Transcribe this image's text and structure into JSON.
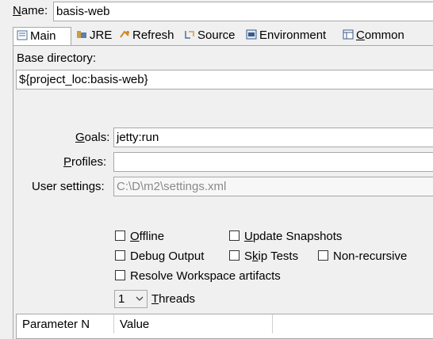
{
  "name": {
    "label_prefix": "N",
    "label_rest": "ame:",
    "value": "basis-web"
  },
  "tabs": [
    {
      "label": "Main",
      "icon": "main-tab-icon"
    },
    {
      "label": "JRE",
      "icon": "jre-icon"
    },
    {
      "label": "Refresh",
      "icon": "refresh-icon"
    },
    {
      "label": "Source",
      "icon": "source-icon"
    },
    {
      "label": "Environment",
      "icon": "environment-icon"
    },
    {
      "label_prefix": "C",
      "label_rest": "ommon",
      "icon": "common-icon"
    }
  ],
  "base_directory": {
    "label": "Base directory:",
    "value": "${project_loc:basis-web}"
  },
  "goals": {
    "label_prefix": "G",
    "label_rest": "oals:",
    "value": "jetty:run"
  },
  "profiles": {
    "label_prefix": "P",
    "label_rest": "rofiles:",
    "value": ""
  },
  "user_settings": {
    "label": "User settings:",
    "value": "C:\\D\\m2\\settings.xml"
  },
  "options": {
    "offline": {
      "u": "O",
      "rest": "ffline"
    },
    "update_snapshots": {
      "u": "U",
      "rest": "pdate Snapshots"
    },
    "debug_output": {
      "pre": "Debu",
      "u": "g",
      "rest": " Output"
    },
    "skip_tests": {
      "pre": "S",
      "u": "k",
      "rest": "ip Tests"
    },
    "non_recursive": {
      "label": "Non-recursive"
    },
    "resolve_workspace": {
      "label": "Resolve Workspace artifacts"
    }
  },
  "threads": {
    "value": "1",
    "label_prefix": "T",
    "label_rest": "hreads"
  },
  "parameters": {
    "col_name": "Parameter N",
    "col_value": "Value"
  }
}
